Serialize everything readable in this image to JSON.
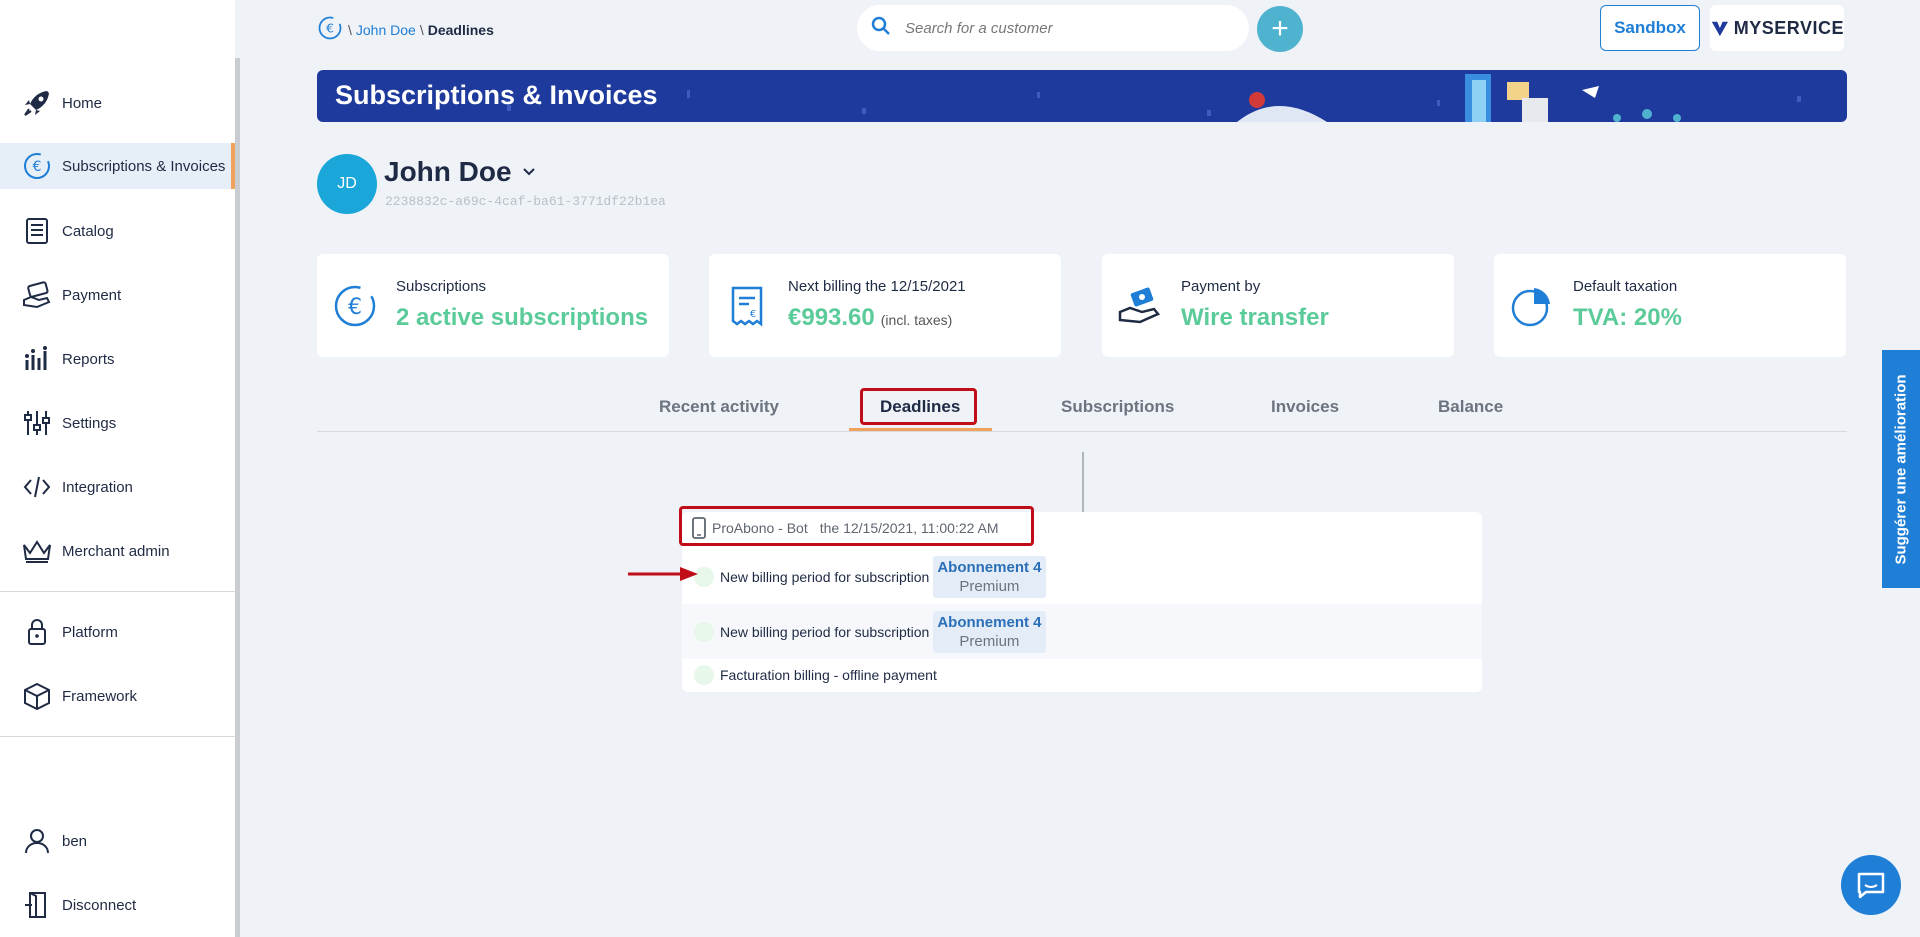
{
  "sidebar": {
    "items": [
      {
        "label": "Home",
        "icon": "rocket-icon"
      },
      {
        "label": "Subscriptions & Invoices",
        "icon": "euro-cycle-icon",
        "active": true
      },
      {
        "label": "Catalog",
        "icon": "catalog-icon"
      },
      {
        "label": "Payment",
        "icon": "payment-icon"
      },
      {
        "label": "Reports",
        "icon": "reports-icon"
      },
      {
        "label": "Settings",
        "icon": "settings-icon"
      },
      {
        "label": "Integration",
        "icon": "code-icon"
      },
      {
        "label": "Merchant admin",
        "icon": "crown-icon"
      }
    ],
    "secondary": [
      {
        "label": "Platform",
        "icon": "lock-icon"
      },
      {
        "label": "Framework",
        "icon": "box-icon"
      }
    ],
    "user": {
      "label": "ben",
      "icon": "user-icon"
    },
    "disconnect": {
      "label": "Disconnect",
      "icon": "door-icon"
    }
  },
  "breadcrumb": {
    "sep": "\\",
    "customer": "John Doe",
    "current": "Deadlines"
  },
  "search": {
    "placeholder": "Search for a customer"
  },
  "header": {
    "add_label": "+",
    "sandbox_label": "Sandbox",
    "brand": "MYSERVICE"
  },
  "banner": {
    "title": "Subscriptions & Invoices"
  },
  "customer": {
    "initials": "JD",
    "name": "John Doe",
    "id": "2238832c-a69c-4caf-ba61-3771df22b1ea"
  },
  "cards": [
    {
      "label": "Subscriptions",
      "value": "2 active subscriptions",
      "icon": "euro-cycle-icon"
    },
    {
      "label": "Next billing the 12/15/2021",
      "value": "€993.60",
      "suffix": "(incl. taxes)",
      "icon": "receipt-icon"
    },
    {
      "label": "Payment by",
      "value": "Wire transfer",
      "icon": "wire-transfer-icon"
    },
    {
      "label": "Default taxation",
      "value": "TVA: 20%",
      "icon": "pie-chart-icon"
    }
  ],
  "tabs": [
    {
      "label": "Recent activity"
    },
    {
      "label": "Deadlines",
      "active": true
    },
    {
      "label": "Subscriptions"
    },
    {
      "label": "Invoices"
    },
    {
      "label": "Balance"
    }
  ],
  "timeline": {
    "actor": "ProAbono - Bot",
    "date": "the 12/15/2021, 11:00:22 AM",
    "rows": [
      {
        "text": "New billing period for subscription",
        "pill_title": "Abonnement 4",
        "pill_sub": "Premium"
      },
      {
        "text": "New billing period for subscription",
        "pill_title": "Abonnement 4",
        "pill_sub": "Premium"
      },
      {
        "text": "Facturation billing - offline payment"
      }
    ]
  },
  "feedback": {
    "label": "Suggérer une amélioration"
  },
  "colors": {
    "accent": "#1f7fd6",
    "success": "#5ccb9a",
    "banner": "#1e3a9c",
    "highlight": "#c00d18",
    "tab_underline": "#f0a25c"
  }
}
